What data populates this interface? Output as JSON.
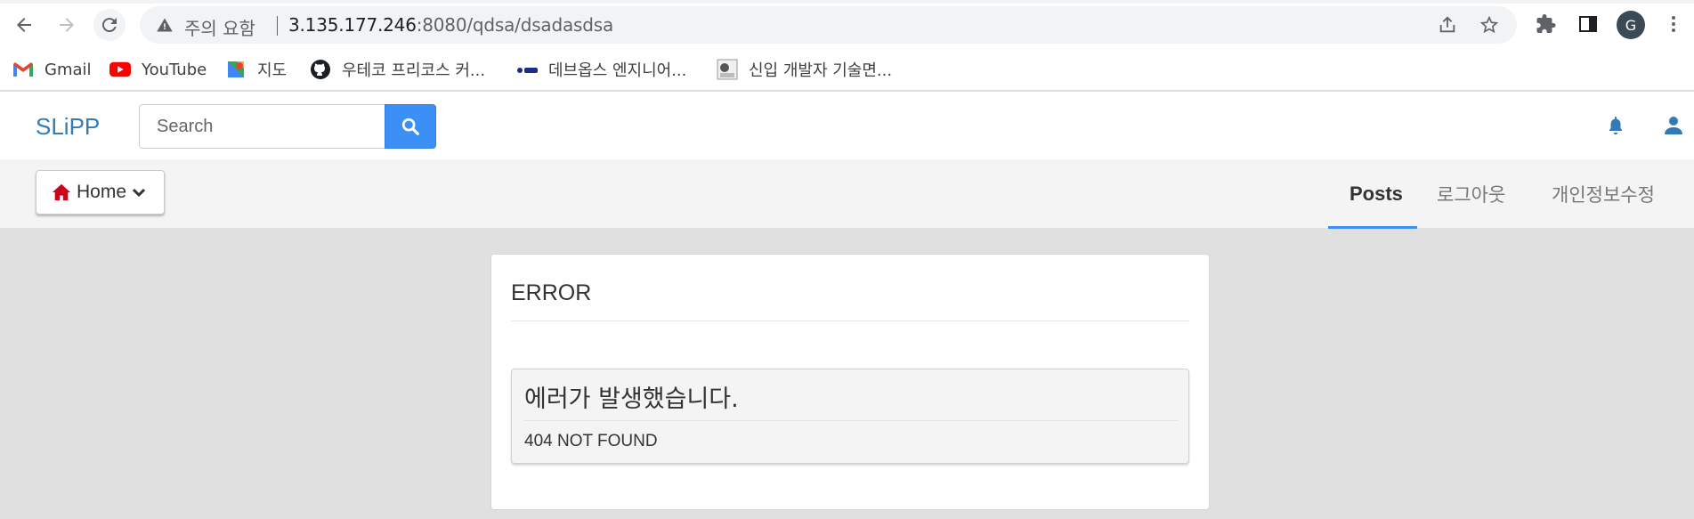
{
  "browser": {
    "security_label": "주의 요함",
    "url_host": "3.135.177.246",
    "url_rest": ":8080/qdsa/dsadasdsa",
    "avatar_letter": "G"
  },
  "bookmarks": [
    {
      "label": "Gmail",
      "icon": "gmail-icon"
    },
    {
      "label": "YouTube",
      "icon": "youtube-icon"
    },
    {
      "label": "지도",
      "icon": "maps-icon"
    },
    {
      "label": "우테코 프리코스 커...",
      "icon": "github-icon"
    },
    {
      "label": "데브옵스 엔지니어...",
      "icon": "devops-icon"
    },
    {
      "label": "신입 개발자 기술면...",
      "icon": "page-thumbnail-icon"
    }
  ],
  "header": {
    "brand": "SLiPP",
    "search_placeholder": "Search"
  },
  "subnav": {
    "home_label": "Home",
    "tabs": [
      "Posts",
      "로그아웃",
      "개인정보수정"
    ]
  },
  "main": {
    "title": "ERROR",
    "alert_heading": "에러가 발생했습니다.",
    "alert_body": "404 NOT FOUND"
  },
  "colors": {
    "brand": "#337ab7",
    "accent": "#3b8ff5",
    "home_icon": "#d0021b"
  }
}
